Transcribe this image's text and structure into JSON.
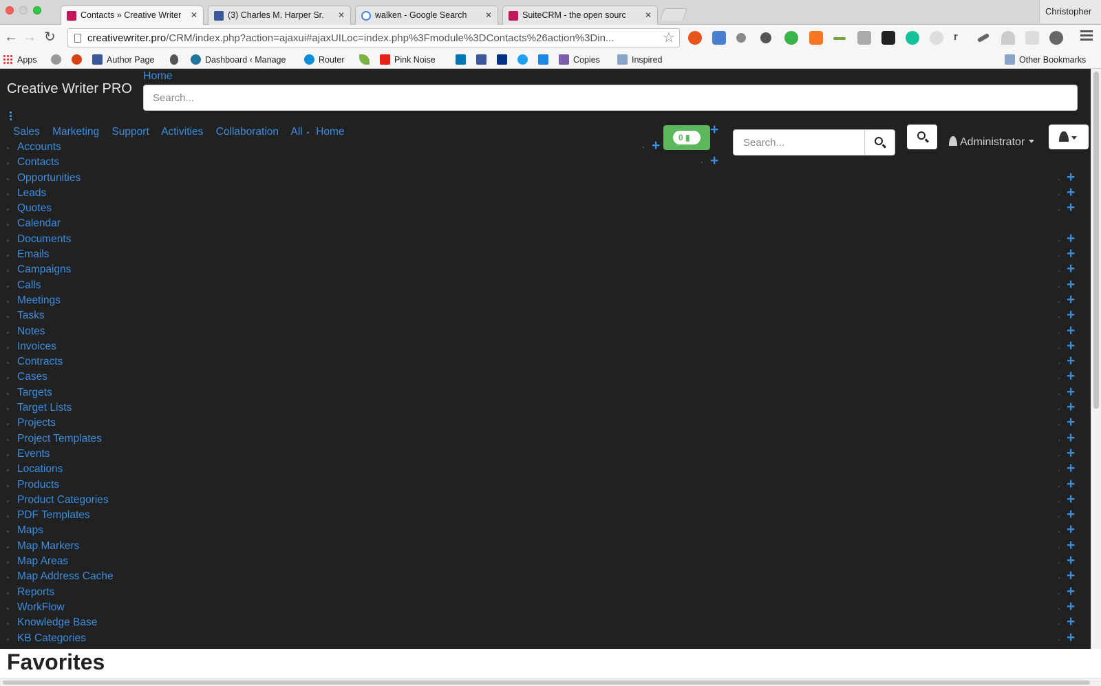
{
  "browser": {
    "tabs": [
      {
        "title": "Contacts » Creative Writer",
        "active": true,
        "favicon_color": "#c2185b"
      },
      {
        "title": "(3) Charles M. Harper Sr.",
        "active": false,
        "favicon_color": "#3b5998"
      },
      {
        "title": "walken - Google Search",
        "active": false,
        "favicon_color": "#4285f4"
      },
      {
        "title": "SuiteCRM - the open sourc",
        "active": false,
        "favicon_color": "#c2185b"
      }
    ],
    "profile_name": "Christopher",
    "url_host": "creativewriter.pro",
    "url_path": "/CRM/index.php?action=ajaxui#ajaxUILoc=index.php%3Fmodule%3DContacts%26action%3Din...",
    "bookmarks": [
      {
        "label": "Apps",
        "icon": "apps-grid-icon"
      },
      {
        "label": "",
        "icon": "gear-icon"
      },
      {
        "label": "",
        "icon": "record-icon"
      },
      {
        "label": "Author Page",
        "icon": "facebook-icon"
      },
      {
        "label": "",
        "icon": "apple-icon"
      },
      {
        "label": "Dashboard ‹ Manage",
        "icon": "wordpress-icon"
      },
      {
        "label": "Router",
        "icon": "att-icon"
      },
      {
        "label": "",
        "icon": "leaf-icon"
      },
      {
        "label": "Pink Noise",
        "icon": "youtube-icon"
      },
      {
        "label": "",
        "icon": "linkedin-icon"
      },
      {
        "label": "",
        "icon": "facebook-icon"
      },
      {
        "label": "",
        "icon": "paypal-icon"
      },
      {
        "label": "",
        "icon": "twitter-icon"
      },
      {
        "label": "",
        "icon": "bookmark-icon"
      },
      {
        "label": "Copies",
        "icon": "grid-icon"
      },
      {
        "label": "Inspired",
        "icon": "folder-icon"
      }
    ],
    "other_bookmarks": "Other Bookmarks"
  },
  "crm": {
    "brand": "Creative Writer PRO",
    "breadcrumb_home": "Home",
    "top_search_placeholder": "Search...",
    "nav": [
      "Sales",
      "Marketing",
      "Support",
      "Activities",
      "Collaboration",
      "All",
      "Home"
    ],
    "notification_count": "0",
    "nav_search_placeholder": "Search...",
    "user_label": "Administrator",
    "accent_color": "#3c8dde",
    "modules": [
      {
        "label": "Accounts",
        "plus": false
      },
      {
        "label": "Contacts",
        "plus": false
      },
      {
        "label": "Opportunities",
        "plus": true
      },
      {
        "label": "Leads",
        "plus": true
      },
      {
        "label": "Quotes",
        "plus": true
      },
      {
        "label": "Calendar",
        "plus": false
      },
      {
        "label": "Documents",
        "plus": true
      },
      {
        "label": "Emails",
        "plus": true
      },
      {
        "label": "Campaigns",
        "plus": true
      },
      {
        "label": "Calls",
        "plus": true
      },
      {
        "label": "Meetings",
        "plus": true
      },
      {
        "label": "Tasks",
        "plus": true
      },
      {
        "label": "Notes",
        "plus": true
      },
      {
        "label": "Invoices",
        "plus": true
      },
      {
        "label": "Contracts",
        "plus": true
      },
      {
        "label": "Cases",
        "plus": true
      },
      {
        "label": "Targets",
        "plus": true
      },
      {
        "label": "Target Lists",
        "plus": true
      },
      {
        "label": "Projects",
        "plus": true
      },
      {
        "label": "Project Templates",
        "plus": true
      },
      {
        "label": "Events",
        "plus": true
      },
      {
        "label": "Locations",
        "plus": true
      },
      {
        "label": "Products",
        "plus": true
      },
      {
        "label": "Product Categories",
        "plus": true
      },
      {
        "label": "PDF Templates",
        "plus": true
      },
      {
        "label": "Maps",
        "plus": true
      },
      {
        "label": "Map Markers",
        "plus": true
      },
      {
        "label": "Map Areas",
        "plus": true
      },
      {
        "label": "Map Address Cache",
        "plus": true
      },
      {
        "label": "Reports",
        "plus": true
      },
      {
        "label": "WorkFlow",
        "plus": true
      },
      {
        "label": "Knowledge Base",
        "plus": true
      },
      {
        "label": "KB Categories",
        "plus": true
      }
    ],
    "favorites_heading": "Favorites"
  }
}
